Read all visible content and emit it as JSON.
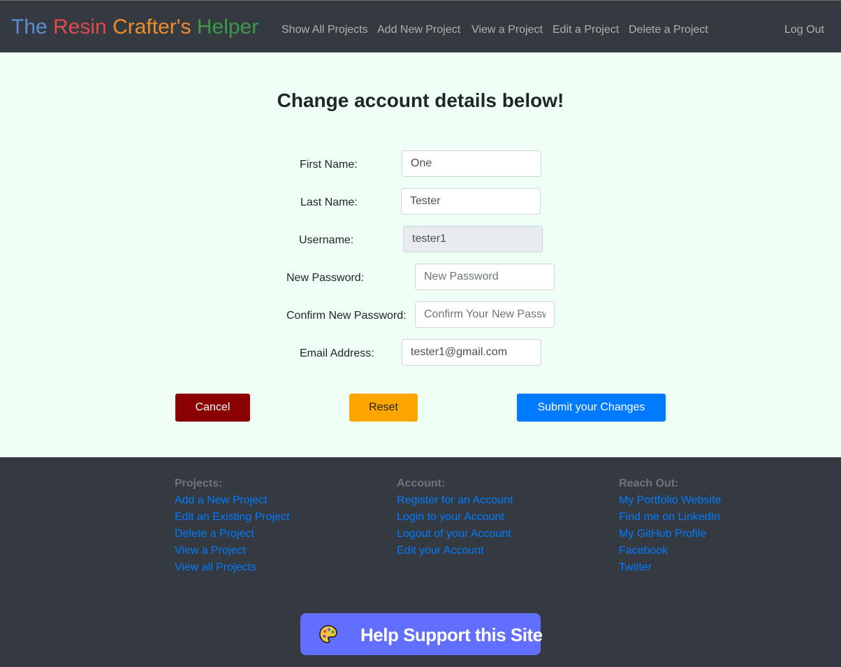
{
  "navbar": {
    "brand": {
      "word1": "The",
      "word2": "Resin",
      "word3": "Crafter's",
      "word4": "Helper"
    },
    "links": [
      "Show All Projects",
      "Add New Project",
      "View a Project",
      "Edit a Project",
      "Delete a Project"
    ],
    "logout": "Log Out"
  },
  "page": {
    "title": "Change account details below!"
  },
  "form": {
    "first_name": {
      "label": "First Name:",
      "value": "One"
    },
    "last_name": {
      "label": "Last Name:",
      "value": "Tester"
    },
    "username": {
      "label": "Username:",
      "value": "tester1"
    },
    "new_password": {
      "label": "New Password:",
      "placeholder": "New Password"
    },
    "confirm_password": {
      "label": "Confirm New Password:",
      "placeholder": "Confirm Your New Password"
    },
    "email": {
      "label": "Email Address:",
      "value": "tester1@gmail.com"
    }
  },
  "buttons": {
    "cancel": "Cancel",
    "reset": "Reset",
    "submit": "Submit your Changes"
  },
  "footer": {
    "projects": {
      "heading": "Projects:",
      "links": [
        "Add a New Project",
        "Edit an Existing Project",
        "Delete a Project",
        "View a Project",
        "View all Projects"
      ]
    },
    "account": {
      "heading": "Account:",
      "links": [
        "Register for an Account",
        "Login to your Account",
        "Logout of your Account",
        "Edit your Account"
      ]
    },
    "reach_out": {
      "heading": "Reach Out:",
      "links": [
        "My Portfolio Website",
        "Find me on LinkedIn",
        "My GitHub Profile",
        "Facebook",
        "Twitter"
      ]
    }
  },
  "support": {
    "label": "Help Support this Site",
    "icon": "palette-icon"
  },
  "colors": {
    "nav_bg": "#343a40",
    "page_bg": "#f0fff6",
    "cancel": "#8b0000",
    "reset": "#ffa500",
    "submit": "#007bff",
    "link": "#007bff",
    "support": "#626ffe"
  }
}
